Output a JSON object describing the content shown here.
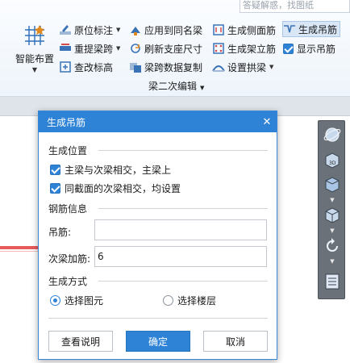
{
  "ribbon": {
    "search_placeholder": "答疑解惑，找图纸",
    "big_button_label": "智能布置",
    "col1": [
      {
        "label": "原位标注",
        "icon": "in-place-annotation-icon",
        "dropdown": true
      },
      {
        "label": "重提梁跨",
        "icon": "re-extract-span-icon",
        "dropdown": true
      },
      {
        "label": "查改标高",
        "icon": "check-elevation-icon",
        "dropdown": false
      }
    ],
    "col2": [
      {
        "label": "应用到同名梁",
        "icon": "apply-same-name-icon",
        "dropdown": false
      },
      {
        "label": "刷新支座尺寸",
        "icon": "refresh-support-icon",
        "dropdown": false
      },
      {
        "label": "梁跨数据复制",
        "icon": "copy-span-data-icon",
        "dropdown": false
      }
    ],
    "col3": [
      {
        "label": "生成侧面筋",
        "icon": "side-rebar-icon",
        "dropdown": false
      },
      {
        "label": "生成架立筋",
        "icon": "erection-rebar-icon",
        "dropdown": false
      },
      {
        "label": "设置拱梁",
        "icon": "arch-beam-icon",
        "dropdown": true
      }
    ],
    "col4": [
      {
        "label": "生成吊筋",
        "icon": "hanger-rebar-icon",
        "selected": true
      },
      {
        "label": "显示吊筋",
        "icon": "checkbox-icon",
        "checked": true
      }
    ],
    "group_label": "梁二次编辑"
  },
  "dialog": {
    "title": "生成吊筋",
    "section_position": "生成位置",
    "check1_label": "主梁与次梁相交，主梁上",
    "check1_checked": true,
    "check2_label": "同截面的次梁相交，均设置",
    "check2_checked": true,
    "section_rebar": "钢筋信息",
    "hanger_label": "吊筋:",
    "hanger_value": "",
    "extra_label": "次梁加筋:",
    "extra_value": "6",
    "section_method": "生成方式",
    "radio1_label": "选择图元",
    "radio1_selected": true,
    "radio2_label": "选择楼层",
    "radio2_selected": false,
    "btn_help": "查看说明",
    "btn_ok": "确定",
    "btn_cancel": "取消"
  },
  "colors": {
    "accent": "#2f83d6",
    "beam_red": "#e65a5a",
    "viewbar_bg": "#6b7178"
  }
}
